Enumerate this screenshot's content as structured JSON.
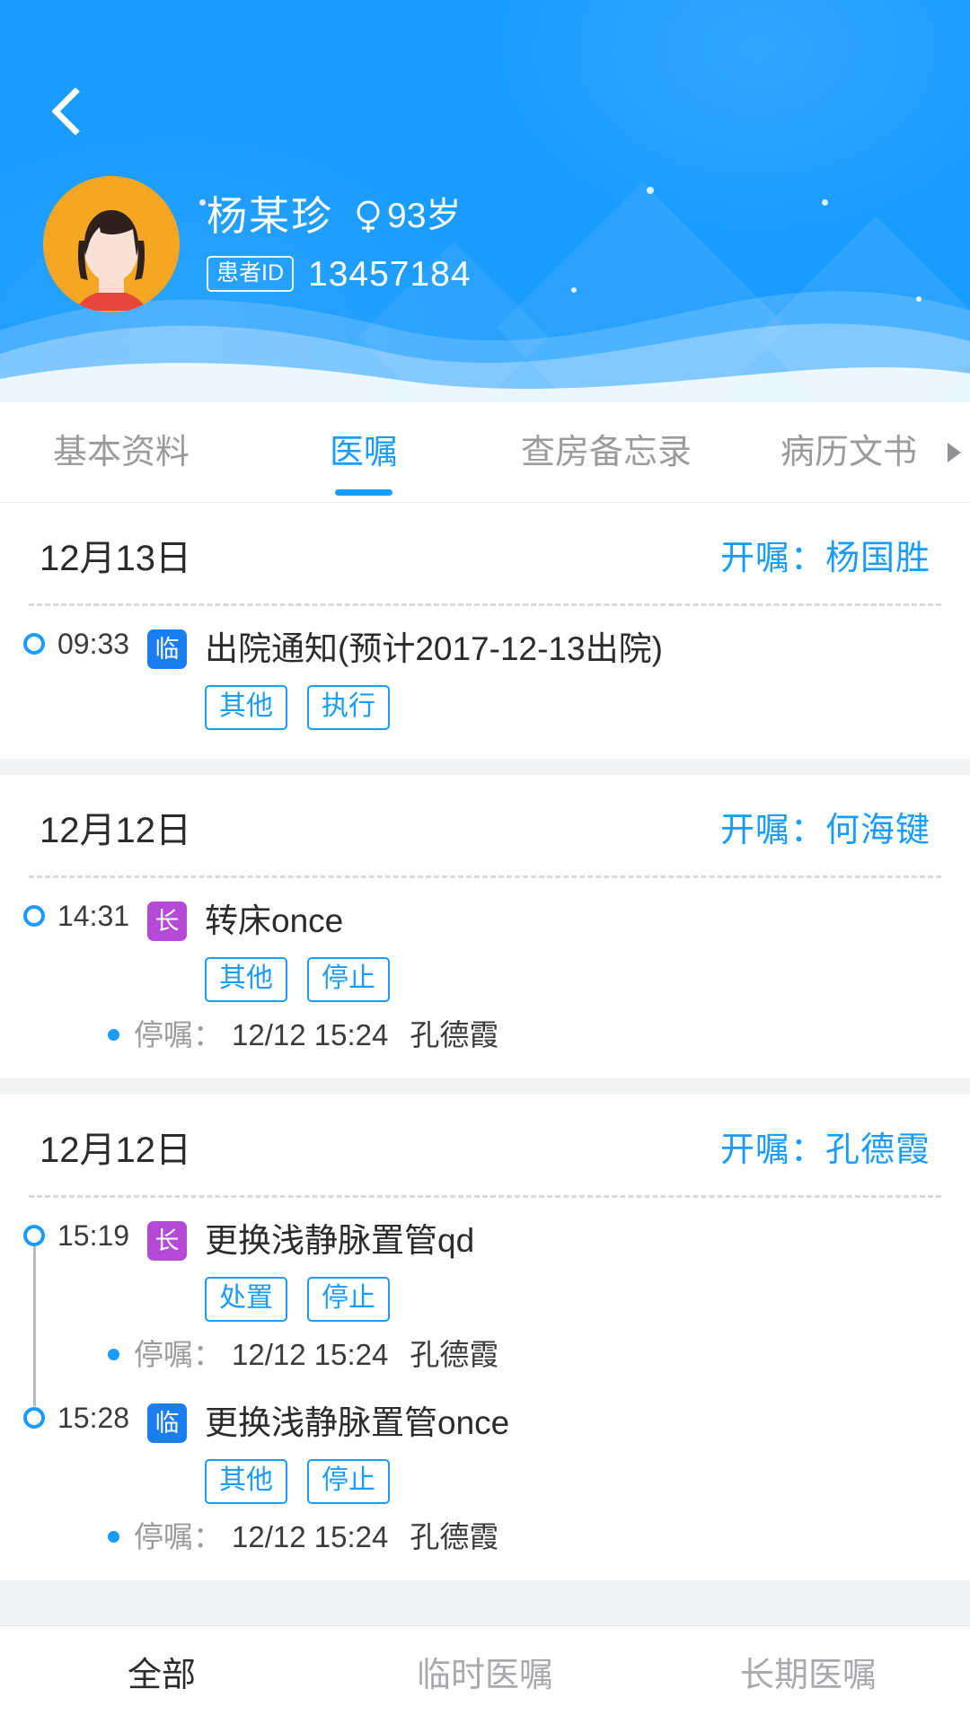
{
  "header": {
    "back_icon": "back-chevron-icon",
    "avatar_icon": "female-patient-avatar",
    "patient_name": "杨某珍",
    "gender_icon": "female-gender-icon",
    "age": "93岁",
    "id_badge_label": "患者ID",
    "patient_id": "13457184",
    "bg_color": "#1a9cff"
  },
  "tabs": [
    {
      "label": "基本资料",
      "active": false
    },
    {
      "label": "医嘱",
      "active": true
    },
    {
      "label": "查房备忘录",
      "active": false
    },
    {
      "label": "病历文书",
      "active": false,
      "arrow_icon": "chevron-right-icon"
    }
  ],
  "cards": [
    {
      "date": "12月13日",
      "doctor": "开嘱：杨国胜",
      "orders": [
        {
          "time": "09:33",
          "type_badge": "临",
          "type": "temp",
          "name": "出院通知(预计2017-12-13出院)",
          "tags": [
            "其他",
            "执行"
          ],
          "stop_note": null
        }
      ]
    },
    {
      "date": "12月12日",
      "doctor": "开嘱：何海键",
      "orders": [
        {
          "time": "14:31",
          "type_badge": "长",
          "type": "long",
          "name": "转床once",
          "tags": [
            "其他",
            "停止"
          ],
          "stop_note": {
            "label": "停嘱：",
            "time": "12/12 15:24",
            "who": "孔德霞"
          }
        }
      ]
    },
    {
      "date": "12月12日",
      "doctor": "开嘱：孔德霞",
      "orders": [
        {
          "time": "15:19",
          "type_badge": "长",
          "type": "long",
          "name": "更换浅静脉置管qd",
          "tags": [
            "处置",
            "停止"
          ],
          "stop_note": {
            "label": "停嘱：",
            "time": "12/12 15:24",
            "who": "孔德霞"
          }
        },
        {
          "time": "15:28",
          "type_badge": "临",
          "type": "temp",
          "name": "更换浅静脉置管once",
          "tags": [
            "其他",
            "停止"
          ],
          "stop_note": {
            "label": "停嘱：",
            "time": "12/12 15:24",
            "who": "孔德霞"
          }
        }
      ]
    }
  ],
  "bottom_nav": [
    {
      "label": "全部",
      "active": true
    },
    {
      "label": "临时医嘱",
      "active": false
    },
    {
      "label": "长期医嘱",
      "active": false
    }
  ],
  "colors": {
    "brand_blue": "#1a9cff",
    "temp_badge": "#1a7ef0",
    "long_badge": "#b44ad6",
    "avatar_bg": "#f5a623"
  }
}
